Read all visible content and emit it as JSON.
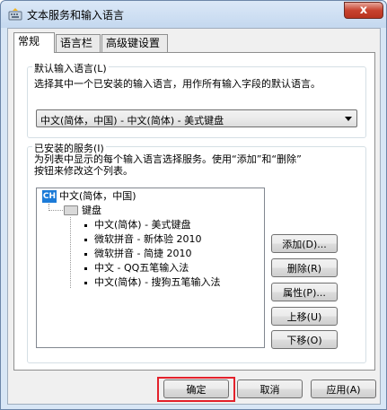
{
  "window": {
    "title": "文本服务和输入语言",
    "close_label": "x"
  },
  "tabs": [
    {
      "label": "常规",
      "active": true
    },
    {
      "label": "语言栏",
      "active": false
    },
    {
      "label": "高级键设置",
      "active": false
    }
  ],
  "default_language": {
    "group_label": "默认输入语言(L)",
    "description": "选择其中一个已安装的输入语言，用作所有输入字段的默认语言。",
    "selected_value": "中文(简体，中国) - 中文(简体) - 美式键盘"
  },
  "installed_services": {
    "group_label": "已安装的服务(I)",
    "description_line1": "为列表中显示的每个输入语言选择服务。使用“添加”和“删除”",
    "description_line2": "按钮来修改这个列表。",
    "language": {
      "badge": "CH",
      "label": "中文(简体，中国)"
    },
    "category": "键盘",
    "items": [
      "中文(简体) - 美式键盘",
      "微软拼音 - 新体验 2010",
      "微软拼音 - 简捷 2010",
      "中文 - QQ五笔输入法",
      "中文(简体) - 搜狗五笔输入法"
    ]
  },
  "side_buttons": {
    "add": "添加(D)...",
    "remove": "删除(R)",
    "properties": "属性(P)...",
    "move_up": "上移(U)",
    "move_down": "下移(O)"
  },
  "footer": {
    "ok": "确定",
    "cancel": "取消",
    "apply": "应用(A)"
  },
  "colors": {
    "highlight": "#e3212b",
    "badge": "#1c7bd8"
  }
}
